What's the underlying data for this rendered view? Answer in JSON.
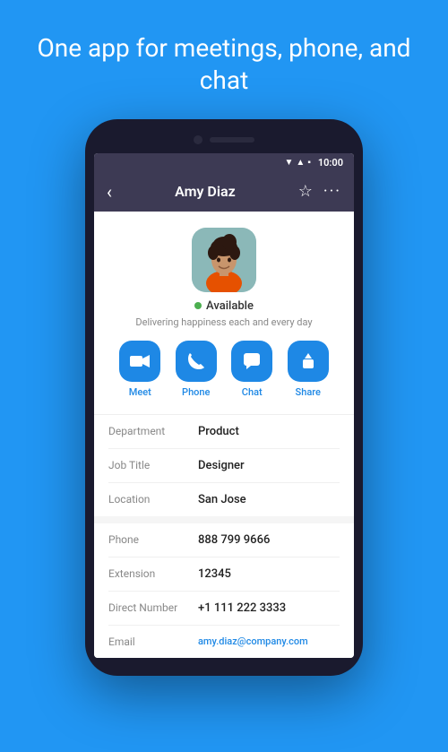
{
  "hero": {
    "text": "One app for meetings, phone, and chat"
  },
  "status_bar": {
    "time": "10:00"
  },
  "header": {
    "title": "Amy Diaz",
    "back_label": "‹",
    "star_label": "☆",
    "more_label": "···"
  },
  "contact": {
    "status": "Available",
    "motto": "Delivering happiness each and every day"
  },
  "actions": [
    {
      "id": "meet",
      "label": "Meet",
      "icon": "📹"
    },
    {
      "id": "phone",
      "label": "Phone",
      "icon": "📞"
    },
    {
      "id": "chat",
      "label": "Chat",
      "icon": "💬"
    },
    {
      "id": "share",
      "label": "Share",
      "icon": "⬆"
    }
  ],
  "info_section1": [
    {
      "label": "Department",
      "value": "Product"
    },
    {
      "label": "Job Title",
      "value": "Designer"
    },
    {
      "label": "Location",
      "value": "San Jose"
    }
  ],
  "info_section2": [
    {
      "label": "Phone",
      "value": "888 799 9666"
    },
    {
      "label": "Extension",
      "value": "12345"
    },
    {
      "label": "Direct Number",
      "value": "+1 111 222 3333"
    },
    {
      "label": "Email",
      "value": "amy.diaz@company.com"
    }
  ]
}
